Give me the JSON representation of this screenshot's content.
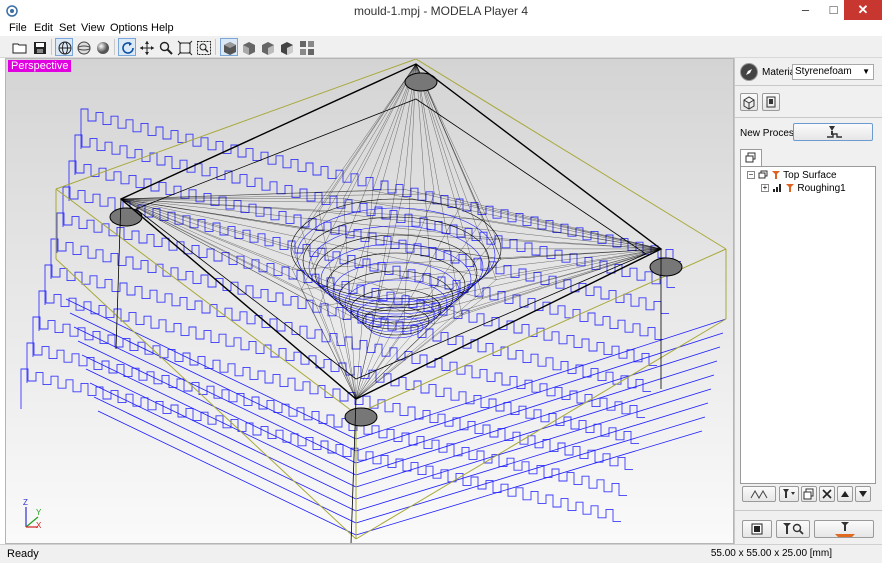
{
  "window": {
    "title": "mould-1.mpj - MODELA Player 4",
    "minimize_glyph": "–",
    "maximize_glyph": "□",
    "close_glyph": "✕"
  },
  "menu": [
    "File",
    "Edit",
    "Set",
    "View",
    "Options",
    "Help"
  ],
  "toolbar": {
    "icons": [
      "open-folder-icon",
      "save-icon",
      "wireframe-icon",
      "mesh-sphere-icon",
      "solid-sphere-icon",
      "rotate-icon",
      "pan-icon",
      "zoom-icon",
      "fit-icon",
      "zoom-window-icon",
      "iso-view-icon",
      "front-view-icon",
      "side-view-icon",
      "back-view-icon",
      "multi-view-icon"
    ],
    "pressed": [
      "wireframe-icon",
      "rotate-icon",
      "iso-view-icon"
    ]
  },
  "viewport": {
    "mode_label": "Perspective",
    "axis_labels": {
      "z": "Z",
      "y": "Y",
      "x": "X"
    },
    "colors": {
      "bounding_box": "#a8a83a",
      "toolpath": "#1a1aff",
      "model": "#000000",
      "label_bg": "#e000e0"
    }
  },
  "panel": {
    "material_label": "Material",
    "material_value": "Styrenefoam",
    "new_process_label": "New Process",
    "tree": {
      "root": "Top Surface",
      "children": [
        "Roughing1"
      ],
      "collapse_glyph": "−",
      "expand_glyph": "+"
    }
  },
  "status": {
    "text": "Ready",
    "dimensions": "55.00 x 55.00 x 25.00 [mm]"
  }
}
